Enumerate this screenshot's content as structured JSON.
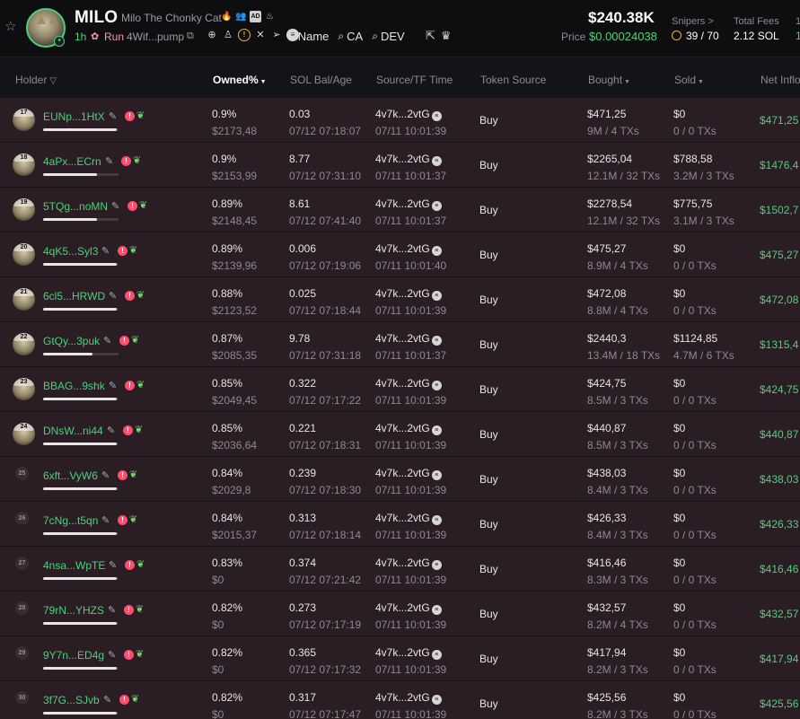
{
  "token": {
    "ticker": "MILO",
    "name": "Milo The Chonky Cat",
    "age": "1h",
    "status": "Run",
    "address": "4Wif...pump",
    "market_cap": "$240.38K",
    "price_label": "Price",
    "price": "$0.00024038",
    "snipers_label": "Snipers >",
    "snipers": "39 / 70",
    "fees_label": "Total Fees",
    "fees": "2.12 SOL",
    "edge_label": "1",
    "edge_value": "1"
  },
  "search_links": [
    {
      "label": "Name",
      "icon": "search-icon"
    },
    {
      "label": "CA",
      "icon": "search-icon"
    },
    {
      "label": "DEV",
      "icon": "search-icon"
    }
  ],
  "columns": {
    "holder": "Holder",
    "owned": "Owned%",
    "sol_bal": "SOL Bal/Age",
    "source": "Source/TF Time",
    "token_source": "Token Source",
    "bought": "Bought",
    "sold": "Sold",
    "net": "Net Inflow"
  },
  "colors": {
    "accent_green": "#4ad37a",
    "row_bg": "#2a1d24",
    "alert": "#ff4d6d"
  },
  "rows": [
    {
      "rank": "17",
      "holder": "EUNp...1HtX",
      "bar": 0.98,
      "pct": "0.9%",
      "usd": "$2173,48",
      "sol": "0.03",
      "time": "07/12 07:18:07",
      "src": "4v7k...2vtG",
      "src_time": "07/11 10:01:39",
      "token_source": "Buy",
      "bought": "$471,25",
      "bought_sub": "9M / 4 TXs",
      "sold": "$0",
      "sold_sub": "0 / 0 TXs",
      "net": "$471,25",
      "avatar": true
    },
    {
      "rank": "18",
      "holder": "4aPx...ECrn",
      "bar": 0.72,
      "pct": "0.9%",
      "usd": "$2153,99",
      "sol": "8.77",
      "time": "07/12 07:31:10",
      "src": "4v7k...2vtG",
      "src_time": "07/11 10:01:37",
      "token_source": "Buy",
      "bought": "$2265,04",
      "bought_sub": "12.1M / 32 TXs",
      "sold": "$788,58",
      "sold_sub": "3.2M / 3 TXs",
      "net": "$1476,4",
      "avatar": true
    },
    {
      "rank": "19",
      "holder": "5TQg...noMN",
      "bar": 0.72,
      "pct": "0.89%",
      "usd": "$2148,45",
      "sol": "8.61",
      "time": "07/12 07:41:40",
      "src": "4v7k...2vtG",
      "src_time": "07/11 10:01:37",
      "token_source": "Buy",
      "bought": "$2278,54",
      "bought_sub": "12.1M / 32 TXs",
      "sold": "$775,75",
      "sold_sub": "3.1M / 3 TXs",
      "net": "$1502,7",
      "avatar": true
    },
    {
      "rank": "20",
      "holder": "4qK5...Syl3",
      "bar": 0.98,
      "pct": "0.89%",
      "usd": "$2139,96",
      "sol": "0.006",
      "time": "07/12 07:19:06",
      "src": "4v7k...2vtG",
      "src_time": "07/11 10:01:40",
      "token_source": "Buy",
      "bought": "$475,27",
      "bought_sub": "8.9M / 4 TXs",
      "sold": "$0",
      "sold_sub": "0 / 0 TXs",
      "net": "$475,27",
      "avatar": true
    },
    {
      "rank": "21",
      "holder": "6cl5...HRWD",
      "bar": 0.98,
      "pct": "0.88%",
      "usd": "$2123,52",
      "sol": "0.025",
      "time": "07/12 07:18:44",
      "src": "4v7k...2vtG",
      "src_time": "07/11 10:01:39",
      "token_source": "Buy",
      "bought": "$472,08",
      "bought_sub": "8.8M / 4 TXs",
      "sold": "$0",
      "sold_sub": "0 / 0 TXs",
      "net": "$472,08",
      "avatar": true
    },
    {
      "rank": "22",
      "holder": "GtQy...3puk",
      "bar": 0.65,
      "pct": "0.87%",
      "usd": "$2085,35",
      "sol": "9.78",
      "time": "07/12 07:31:18",
      "src": "4v7k...2vtG",
      "src_time": "07/11 10:01:37",
      "token_source": "Buy",
      "bought": "$2440,3",
      "bought_sub": "13.4M / 18 TXs",
      "sold": "$1124,85",
      "sold_sub": "4.7M / 6 TXs",
      "net": "$1315,4",
      "avatar": true
    },
    {
      "rank": "23",
      "holder": "BBAG...9shk",
      "bar": 0.98,
      "pct": "0.85%",
      "usd": "$2049,45",
      "sol": "0.322",
      "time": "07/12 07:17:22",
      "src": "4v7k...2vtG",
      "src_time": "07/11 10:01:39",
      "token_source": "Buy",
      "bought": "$424,75",
      "bought_sub": "8.5M / 3 TXs",
      "sold": "$0",
      "sold_sub": "0 / 0 TXs",
      "net": "$424,75",
      "avatar": true
    },
    {
      "rank": "24",
      "holder": "DNsW...ni44",
      "bar": 0.98,
      "pct": "0.85%",
      "usd": "$2036,64",
      "sol": "0.221",
      "time": "07/12 07:18:31",
      "src": "4v7k...2vtG",
      "src_time": "07/11 10:01:39",
      "token_source": "Buy",
      "bought": "$440,87",
      "bought_sub": "8.5M / 3 TXs",
      "sold": "$0",
      "sold_sub": "0 / 0 TXs",
      "net": "$440,87",
      "avatar": true
    },
    {
      "rank": "25",
      "holder": "6xft...VyW6",
      "bar": 0.98,
      "pct": "0.84%",
      "usd": "$2029,8",
      "sol": "0.239",
      "time": "07/12 07:18:30",
      "src": "4v7k...2vtG",
      "src_time": "07/11 10:01:39",
      "token_source": "Buy",
      "bought": "$438,03",
      "bought_sub": "8.4M / 3 TXs",
      "sold": "$0",
      "sold_sub": "0 / 0 TXs",
      "net": "$438,03",
      "avatar": false
    },
    {
      "rank": "26",
      "holder": "7cNg...t5qn",
      "bar": 0.98,
      "pct": "0.84%",
      "usd": "$2015,37",
      "sol": "0.313",
      "time": "07/12 07:18:14",
      "src": "4v7k...2vtG",
      "src_time": "07/11 10:01:39",
      "token_source": "Buy",
      "bought": "$426,33",
      "bought_sub": "8.4M / 3 TXs",
      "sold": "$0",
      "sold_sub": "0 / 0 TXs",
      "net": "$426,33",
      "avatar": false
    },
    {
      "rank": "27",
      "holder": "4nsa...WpTE",
      "bar": 0.98,
      "pct": "0.83%",
      "usd": "$0",
      "sol": "0.374",
      "time": "07/12 07:21:42",
      "src": "4v7k...2vtG",
      "src_time": "07/11 10:01:39",
      "token_source": "Buy",
      "bought": "$416,46",
      "bought_sub": "8.3M / 3 TXs",
      "sold": "$0",
      "sold_sub": "0 / 0 TXs",
      "net": "$416,46",
      "avatar": false
    },
    {
      "rank": "28",
      "holder": "79rN...YHZS",
      "bar": 0.98,
      "pct": "0.82%",
      "usd": "$0",
      "sol": "0.273",
      "time": "07/12 07:17:19",
      "src": "4v7k...2vtG",
      "src_time": "07/11 10:01:39",
      "token_source": "Buy",
      "bought": "$432,57",
      "bought_sub": "8.2M / 4 TXs",
      "sold": "$0",
      "sold_sub": "0 / 0 TXs",
      "net": "$432,57",
      "avatar": false
    },
    {
      "rank": "29",
      "holder": "9Y7n...ED4g",
      "bar": 0.98,
      "pct": "0.82%",
      "usd": "$0",
      "sol": "0.365",
      "time": "07/12 07:17:32",
      "src": "4v7k...2vtG",
      "src_time": "07/11 10:01:39",
      "token_source": "Buy",
      "bought": "$417,94",
      "bought_sub": "8.2M / 3 TXs",
      "sold": "$0",
      "sold_sub": "0 / 0 TXs",
      "net": "$417,94",
      "avatar": false
    },
    {
      "rank": "30",
      "holder": "3f7G...SJvb",
      "bar": 0.98,
      "pct": "0.82%",
      "usd": "$0",
      "sol": "0.317",
      "time": "07/12 07:17:47",
      "src": "4v7k...2vtG",
      "src_time": "07/11 10:01:39",
      "token_source": "Buy",
      "bought": "$425,56",
      "bought_sub": "8.2M / 3 TXs",
      "sold": "$0",
      "sold_sub": "0 / 0 TXs",
      "net": "$425,56",
      "avatar": false
    }
  ]
}
